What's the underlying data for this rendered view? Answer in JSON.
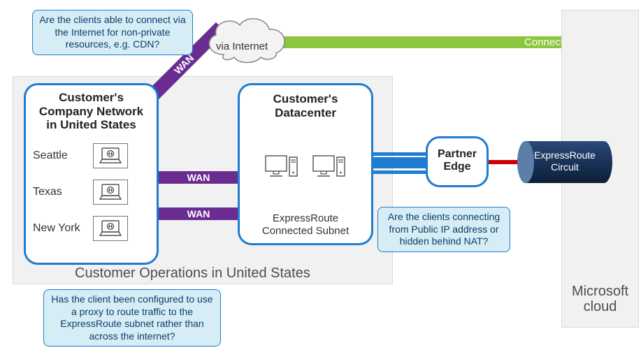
{
  "ops": {
    "label": "Customer Operations in United States"
  },
  "msCloud": {
    "label": "Microsoft\ncloud"
  },
  "greenBar": {
    "label": "Connection to Microsoft"
  },
  "customerNet": {
    "title": "Customer's\nCompany Network\nin United States",
    "cities": [
      "Seattle",
      "Texas",
      "New York"
    ]
  },
  "datacenter": {
    "title": "Customer's\nDatacenter",
    "subtext": "ExpressRoute\nConnected Subnet"
  },
  "partnerEdge": {
    "title": "Partner\nEdge"
  },
  "wan": {
    "label": "WAN"
  },
  "cloud": {
    "label": "via Internet"
  },
  "expressRoute": {
    "label": "ExpressRoute\nCircuit"
  },
  "callouts": {
    "cdn": "Are the clients able to connect via the Internet for non-private resources, e.g. CDN?",
    "proxy": "Has the client been configured to use a proxy to route traffic to the ExpressRoute subnet rather than across the internet?",
    "nat": "Are the clients connecting from Public IP address or hidden behind NAT?"
  }
}
